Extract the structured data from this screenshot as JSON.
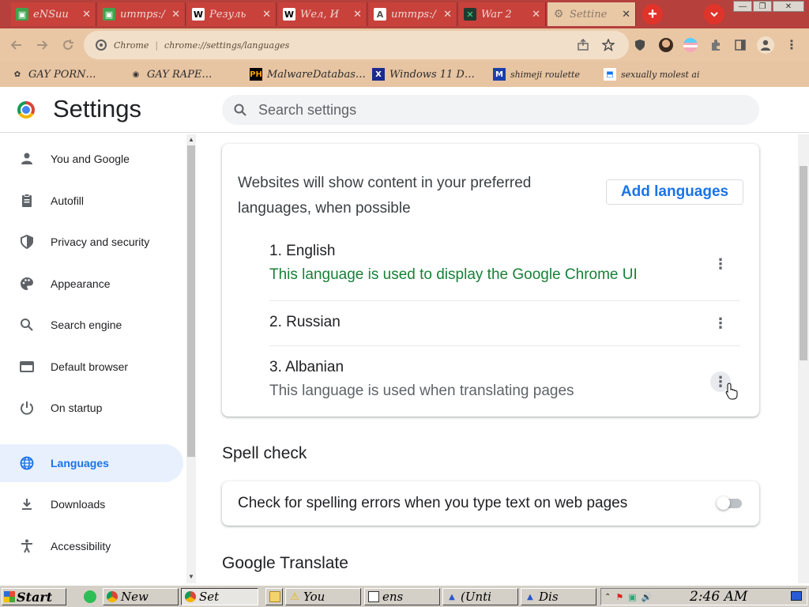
{
  "browser": {
    "tabs": [
      {
        "title": "eNSии",
        "fav": "▣",
        "fav_color": "#3fa34d"
      },
      {
        "title": "иттрs:/",
        "fav": "▣",
        "fav_color": "#3fa34d"
      },
      {
        "title": "Резуль",
        "fav": "W",
        "fav_color": "#ffffff"
      },
      {
        "title": "Wел, И",
        "fav": "W",
        "fav_color": "#ffffff"
      },
      {
        "title": "иттрs:/",
        "fav": "A",
        "fav_color": "#ffffff"
      },
      {
        "title": "War 2",
        "fav": "✕",
        "fav_color": "#1f3a2f"
      },
      {
        "title": "Settinе",
        "fav": "⚙",
        "fav_color": "#e9c8a6"
      }
    ],
    "address": {
      "host": "Chrome",
      "url": "chrome://settings/languages"
    },
    "bookmarks": [
      {
        "label": "GAY PORN…",
        "fav": "✿"
      },
      {
        "label": "GAY RAPE…",
        "fav": "◉"
      },
      {
        "label": "MalwareDatabas…",
        "fav": "PH"
      },
      {
        "label": "Windows 11 D…",
        "fav": "X"
      },
      {
        "label": "shimeji roulette",
        "fav": "M"
      },
      {
        "label": "sexually molest ai",
        "fav": "⬒"
      }
    ]
  },
  "settings": {
    "title": "Settings",
    "search_placeholder": "Search settings"
  },
  "sidebar": {
    "items": [
      {
        "label": "You and Google",
        "icon": "person-icon"
      },
      {
        "label": "Autofill",
        "icon": "clipboard-icon"
      },
      {
        "label": "Privacy and security",
        "icon": "shield-icon"
      },
      {
        "label": "Appearance",
        "icon": "palette-icon"
      },
      {
        "label": "Search engine",
        "icon": "search-icon"
      },
      {
        "label": "Default browser",
        "icon": "browser-icon"
      },
      {
        "label": "On startup",
        "icon": "power-icon"
      },
      {
        "label": "Languages",
        "icon": "globe-icon"
      },
      {
        "label": "Downloads",
        "icon": "download-icon"
      },
      {
        "label": "Accessibility",
        "icon": "accessibility-icon"
      }
    ]
  },
  "languages": {
    "description": "Websites will show content in your preferred languages, when possible",
    "add_button": "Add languages",
    "list": [
      {
        "name": "1. English",
        "note": "This language is used to display the Google Chrome UI",
        "note_color": "#188038"
      },
      {
        "name": "2. Russian",
        "note": "",
        "note_color": "#5f6368"
      },
      {
        "name": "3. Albanian",
        "note": "This language is used when translating pages",
        "note_color": "#5f6368"
      }
    ]
  },
  "spell_check": {
    "title": "Spell check",
    "toggle_label": "Check for spelling errors when you type text on web pages",
    "enabled": false
  },
  "google_translate": {
    "title": "Google Translate"
  },
  "taskbar": {
    "start": "Start",
    "buttons": [
      {
        "label": "New",
        "icon": "chrome-icon"
      },
      {
        "label": "Set",
        "icon": "chrome-icon"
      },
      {
        "label": "",
        "icon": "folder-icon"
      },
      {
        "label": "You",
        "icon": "warning-icon"
      },
      {
        "label": "ens",
        "icon": "window-icon"
      },
      {
        "label": "(Unti",
        "icon": "app-icon"
      },
      {
        "label": "Dis",
        "icon": "app-icon"
      }
    ],
    "clock": "2:46 AM"
  },
  "colors": {
    "accent": "#1a73e8",
    "active_nav_bg": "#e8f0fe",
    "ui_note_green": "#188038",
    "tab_strip": "#b5403c"
  }
}
